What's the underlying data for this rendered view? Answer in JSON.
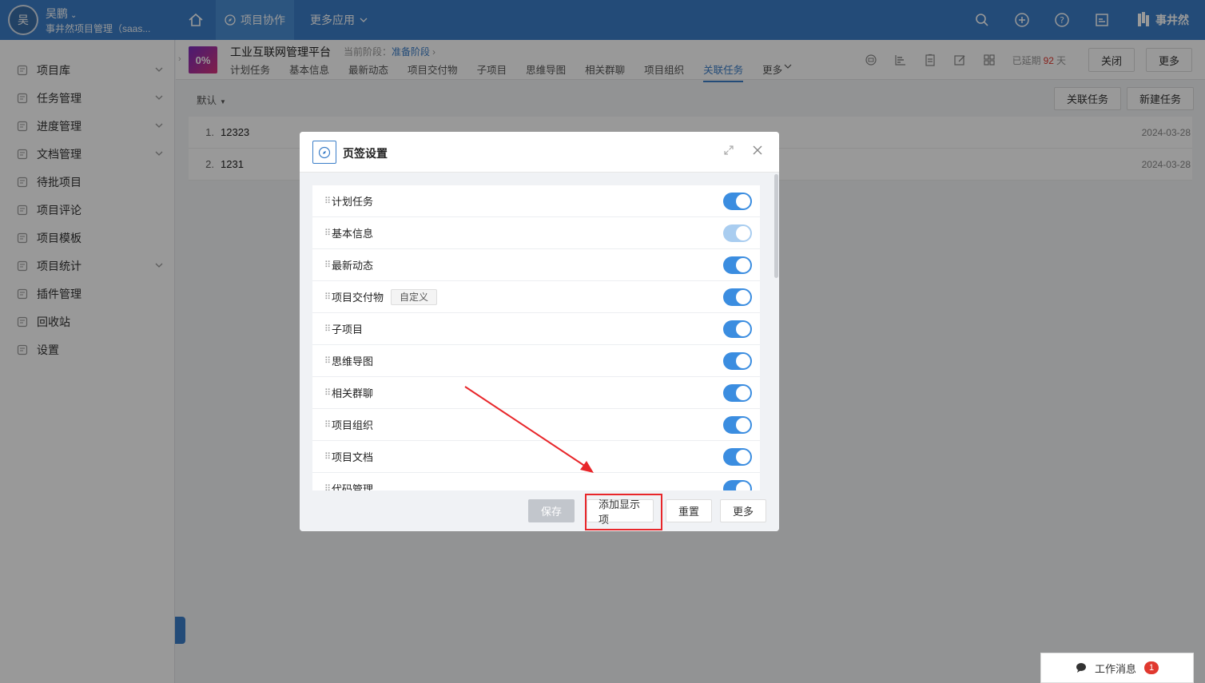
{
  "topbar": {
    "avatar_char": "吴",
    "user_name": "吴鹏",
    "org_name": "事井然项目管理（saas...",
    "nav_active": "项目协作",
    "nav_more": "更多应用",
    "brand": "事井然"
  },
  "sidebar": {
    "items": [
      {
        "label": "项目库",
        "icon": "project-lib-icon",
        "has_chevron": true
      },
      {
        "label": "任务管理",
        "icon": "task-icon",
        "has_chevron": true
      },
      {
        "label": "进度管理",
        "icon": "progress-icon",
        "has_chevron": true
      },
      {
        "label": "文档管理",
        "icon": "document-icon",
        "has_chevron": true
      },
      {
        "label": "待批项目",
        "icon": "approval-icon",
        "has_chevron": false
      },
      {
        "label": "项目评论",
        "icon": "comment-icon",
        "has_chevron": false
      },
      {
        "label": "项目模板",
        "icon": "template-icon",
        "has_chevron": false
      },
      {
        "label": "项目统计",
        "icon": "stats-icon",
        "has_chevron": true
      },
      {
        "label": "插件管理",
        "icon": "plugin-icon",
        "has_chevron": false
      },
      {
        "label": "回收站",
        "icon": "trash-icon",
        "has_chevron": false
      },
      {
        "label": "设置",
        "icon": "gear-icon",
        "has_chevron": false
      }
    ]
  },
  "project": {
    "progress": "0%",
    "title": "工业互联网管理平台",
    "stage_label": "当前阶段：",
    "stage_value": "准备阶段",
    "tabs": [
      "计划任务",
      "基本信息",
      "最新动态",
      "项目交付物",
      "子项目",
      "思维导图",
      "相关群聊",
      "项目组织",
      "关联任务",
      "更多"
    ],
    "active_tab": "关联任务",
    "delay_prefix": "已延期",
    "delay_days": "92",
    "delay_suffix": "天",
    "close_btn": "关闭",
    "more_btn": "更多"
  },
  "subbar": {
    "sort_label": "默认",
    "link_task_btn": "关联任务",
    "new_task_btn": "新建任务"
  },
  "tasks": [
    {
      "index": "1.",
      "name": "12323",
      "date": "2024-03-28"
    },
    {
      "index": "2.",
      "name": "1231",
      "date": "2024-03-28"
    }
  ],
  "modal": {
    "title": "页签设置",
    "rows": [
      {
        "label": "计划任务",
        "enabled": true,
        "locked": false
      },
      {
        "label": "基本信息",
        "enabled": true,
        "locked": true
      },
      {
        "label": "最新动态",
        "enabled": true,
        "locked": false
      },
      {
        "label": "项目交付物",
        "enabled": true,
        "locked": false,
        "tag": "自定义"
      },
      {
        "label": "子项目",
        "enabled": true,
        "locked": false
      },
      {
        "label": "思维导图",
        "enabled": true,
        "locked": false
      },
      {
        "label": "相关群聊",
        "enabled": true,
        "locked": false
      },
      {
        "label": "项目组织",
        "enabled": true,
        "locked": false
      },
      {
        "label": "项目文档",
        "enabled": true,
        "locked": false
      },
      {
        "label": "代码管理",
        "enabled": true,
        "locked": false
      }
    ],
    "buttons": {
      "save": "保存",
      "add": "添加显示项",
      "reset": "重置",
      "more": "更多"
    }
  },
  "work_message": {
    "label": "工作消息",
    "count": "1"
  },
  "colors": {
    "primary": "#3b7ec8",
    "highlight": "#e8262a",
    "danger": "#e0382f"
  }
}
